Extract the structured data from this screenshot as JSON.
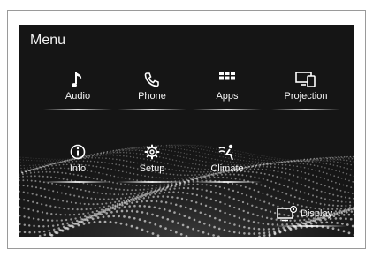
{
  "menu": {
    "title": "Menu",
    "items": [
      {
        "label": "Audio",
        "icon": "music-note-icon"
      },
      {
        "label": "Phone",
        "icon": "phone-icon"
      },
      {
        "label": "Apps",
        "icon": "apps-grid-icon"
      },
      {
        "label": "Projection",
        "icon": "projection-icon"
      },
      {
        "label": "Info",
        "icon": "info-icon"
      },
      {
        "label": "Setup",
        "icon": "gear-icon"
      },
      {
        "label": "Climate",
        "icon": "climate-icon"
      }
    ],
    "display_label": "Display"
  },
  "colors": {
    "screen_bg": "#151515",
    "text": "#f5f5f5"
  }
}
